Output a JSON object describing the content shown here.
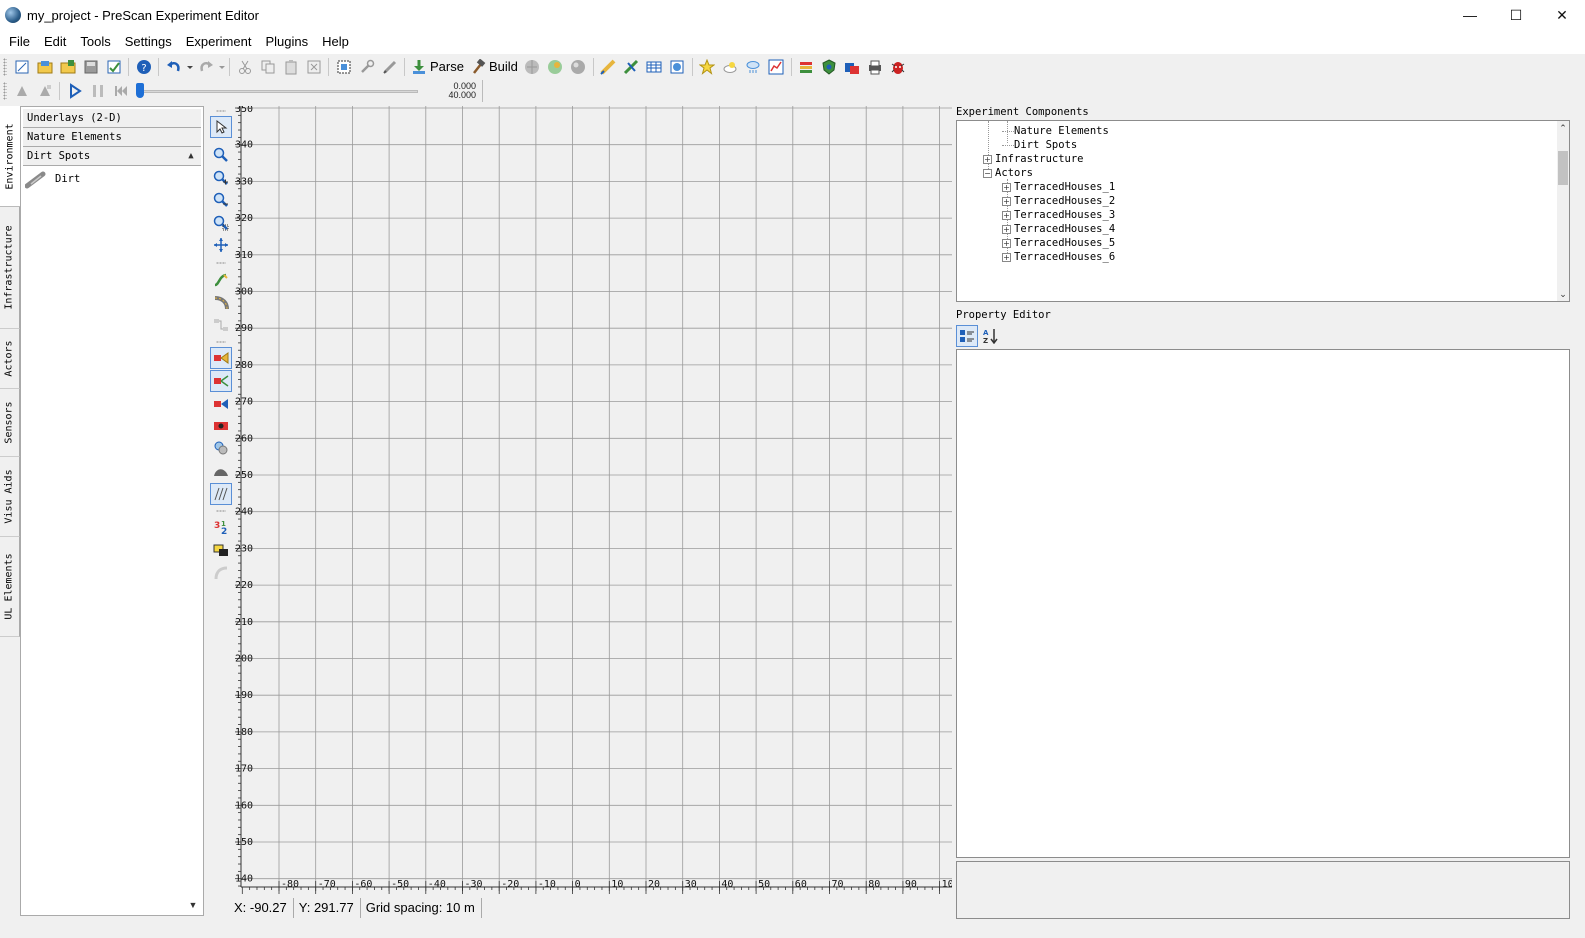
{
  "window": {
    "title": "my_project - PreScan Experiment Editor",
    "controls": {
      "minimize": "—",
      "maximize": "☐",
      "close": "✕"
    }
  },
  "menu": [
    "File",
    "Edit",
    "Tools",
    "Settings",
    "Experiment",
    "Plugins",
    "Help"
  ],
  "toolbar": {
    "parse_label": "Parse",
    "build_label": "Build"
  },
  "playback": {
    "time_current": "0.000",
    "time_total": "40.000",
    "progress": 0
  },
  "left_tabs": [
    "Environment",
    "Infrastructure",
    "Actors",
    "Sensors",
    "Visu Aids",
    "UL Elements"
  ],
  "library": {
    "sections": [
      "Underlays (2-D)",
      "Nature Elements",
      "Dirt Spots"
    ],
    "items": [
      "Dirt"
    ]
  },
  "canvas": {
    "x_ticks": [
      "-80",
      "-70",
      "-60",
      "-50",
      "-40",
      "-30",
      "-20",
      "-10",
      "0",
      "10",
      "20",
      "30",
      "40",
      "50",
      "60",
      "70",
      "80",
      "90",
      "10"
    ],
    "y_ticks": [
      "350",
      "340",
      "330",
      "320",
      "310",
      "300",
      "290",
      "280",
      "270",
      "260",
      "250",
      "240",
      "230",
      "220",
      "210",
      "200",
      "190",
      "180",
      "170",
      "160",
      "150",
      "140"
    ]
  },
  "status": {
    "x": "X: -90.27",
    "y": "Y: 291.77",
    "grid": "Grid spacing: 10 m"
  },
  "components": {
    "title": "Experiment Components",
    "rows": [
      {
        "label": "Nature Elements",
        "level": 2,
        "expander": ""
      },
      {
        "label": "Dirt Spots",
        "level": 2,
        "expander": ""
      },
      {
        "label": "Infrastructure",
        "level": 1,
        "expander": "+"
      },
      {
        "label": "Actors",
        "level": 1,
        "expander": "−"
      },
      {
        "label": "TerracedHouses_1",
        "level": 2,
        "expander": "+"
      },
      {
        "label": "TerracedHouses_2",
        "level": 2,
        "expander": "+"
      },
      {
        "label": "TerracedHouses_3",
        "level": 2,
        "expander": "+"
      },
      {
        "label": "TerracedHouses_4",
        "level": 2,
        "expander": "+"
      },
      {
        "label": "TerracedHouses_5",
        "level": 2,
        "expander": "+"
      },
      {
        "label": "TerracedHouses_6",
        "level": 2,
        "expander": "+"
      }
    ]
  },
  "property_editor": {
    "title": "Property Editor"
  },
  "colors": {
    "accent": "#1e6fd6",
    "grid_line": "#9a9a9a",
    "canvas_bg": "#f0f0f0"
  }
}
